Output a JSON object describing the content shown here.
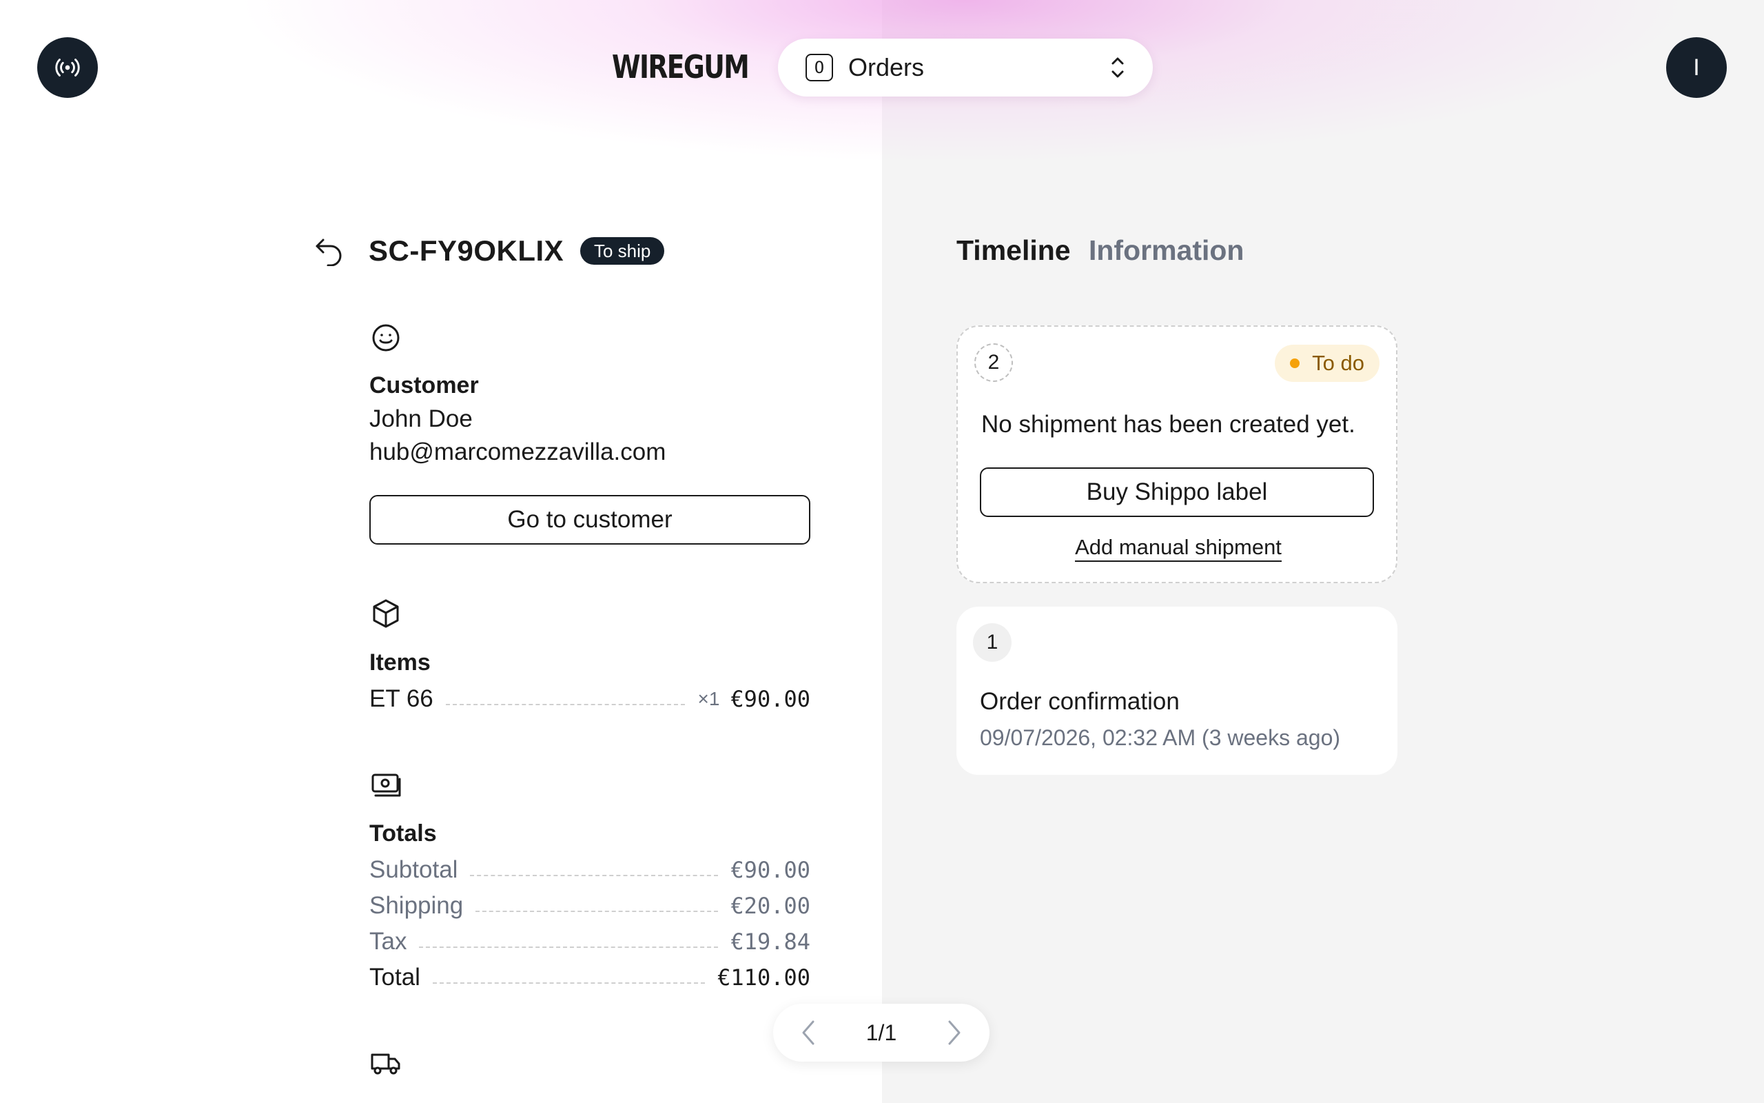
{
  "header": {
    "logo": "WIREGUM",
    "selector": {
      "shortcut": "O",
      "label": "Orders"
    },
    "user_initial": "I"
  },
  "order": {
    "id": "SC-FY9OKLIX",
    "status": "To ship"
  },
  "customer": {
    "title": "Customer",
    "name": "John Doe",
    "email": "hub@marcomezzavilla.com",
    "button": "Go to customer"
  },
  "items": {
    "title": "Items",
    "list": [
      {
        "name": "ET 66",
        "qty": "×1",
        "price": "€90.00"
      }
    ]
  },
  "totals": {
    "title": "Totals",
    "subtotal": {
      "label": "Subtotal",
      "value": "€90.00"
    },
    "shipping": {
      "label": "Shipping",
      "value": "€20.00"
    },
    "tax": {
      "label": "Tax",
      "value": "€19.84"
    },
    "total": {
      "label": "Total",
      "value": "€110.00"
    }
  },
  "pager": {
    "text": "1/1"
  },
  "tabs": {
    "timeline": "Timeline",
    "information": "Information"
  },
  "timeline": {
    "shipment": {
      "step": "2",
      "badge": "To do",
      "message": "No shipment has been created yet.",
      "button": "Buy Shippo label",
      "link": "Add manual shipment"
    },
    "confirmation": {
      "step": "1",
      "title": "Order confirmation",
      "date": "09/07/2026, 02:32 AM (3 weeks ago)"
    }
  },
  "colors": {
    "dark": "#16202b",
    "muted": "#6b7280",
    "todo_bg": "#fdf3dc",
    "todo_dot": "#f5a10a",
    "panel_bg": "#f4f4f4"
  }
}
